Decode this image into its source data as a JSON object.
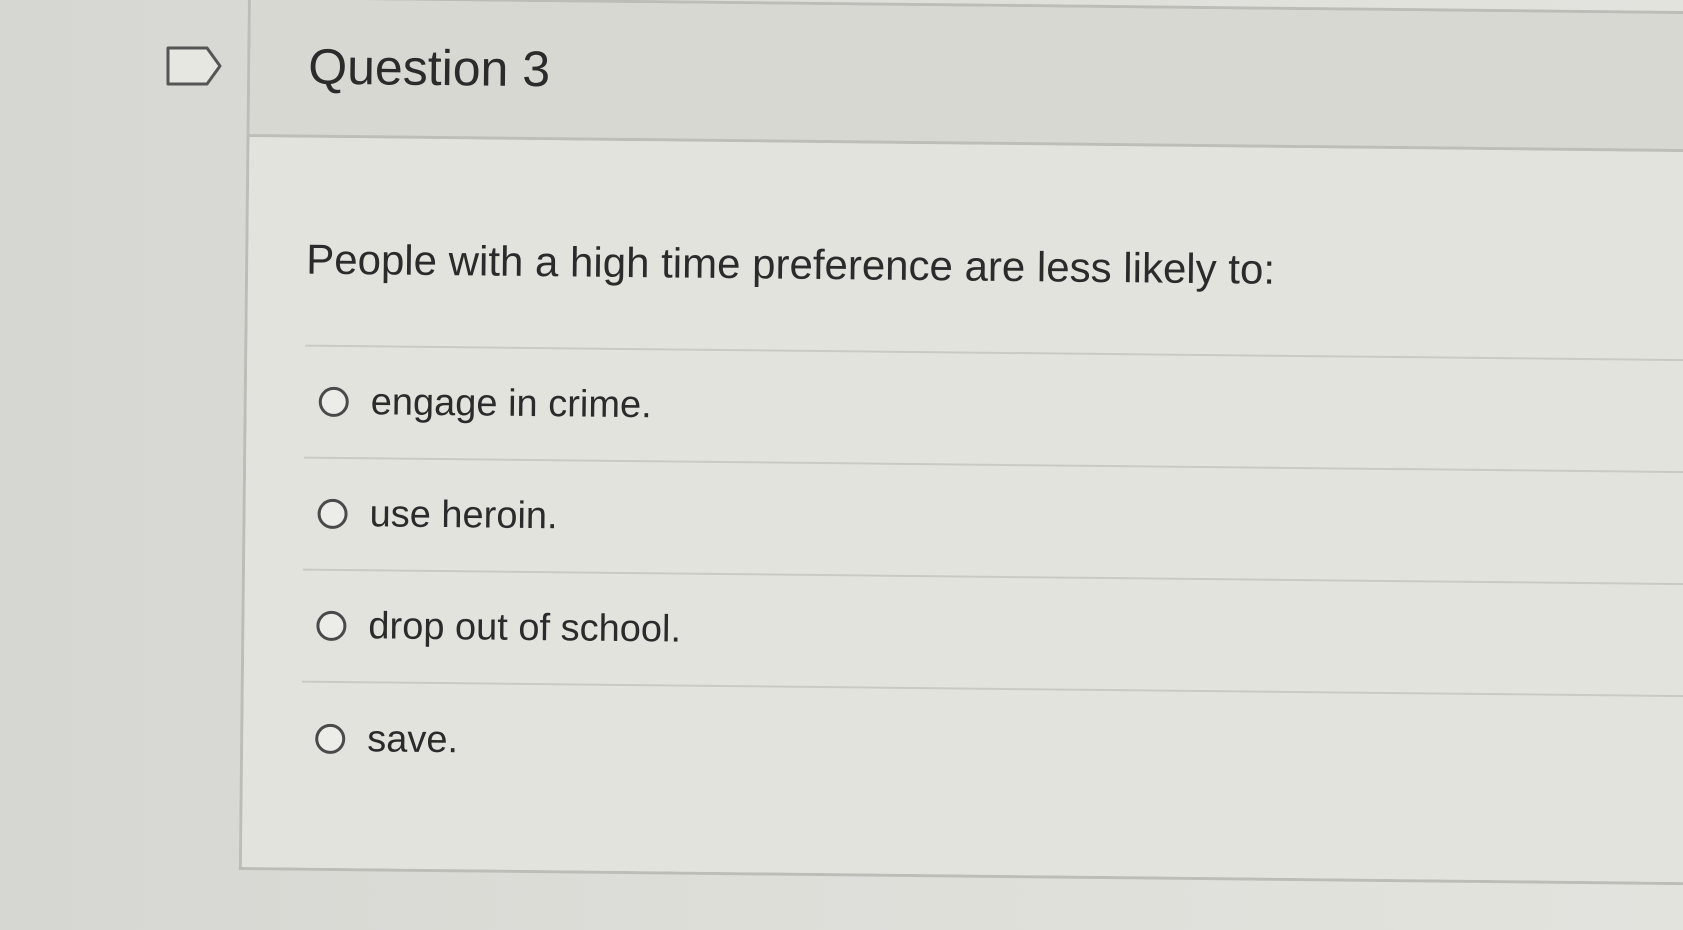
{
  "question": {
    "title": "Question 3",
    "prompt": "People with a high time preference are less likely to:",
    "answers": [
      {
        "label": "engage in crime."
      },
      {
        "label": "use heroin."
      },
      {
        "label": "drop out of school."
      },
      {
        "label": "save."
      }
    ]
  },
  "icons": {
    "flag": "flag-question-icon",
    "radio": "radio-unselected-icon"
  },
  "colors": {
    "background": "#dcdcd8",
    "card": "#e3e3de",
    "header": "#d8d8d3",
    "text": "#2b2b2b",
    "border": "#bdbdb8"
  }
}
